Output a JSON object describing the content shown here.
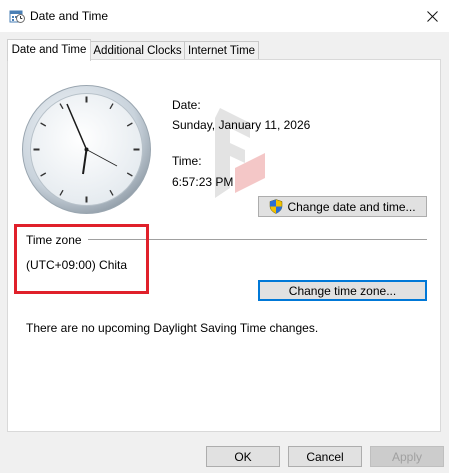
{
  "window": {
    "title": "Date and Time",
    "icon": "date-time-icon",
    "close_icon": "close-icon"
  },
  "tabs": [
    {
      "label": "Date and Time",
      "active": true
    },
    {
      "label": "Additional Clocks",
      "active": false
    },
    {
      "label": "Internet Time",
      "active": false
    }
  ],
  "datetime": {
    "date_label": "Date:",
    "date_value": "Sunday, January 11, 2026",
    "time_label": "Time:",
    "time_value": "6:57:23 PM",
    "change_button": "Change date and time...",
    "shield_icon": "uac-shield-icon"
  },
  "timezone": {
    "section_label": "Time zone",
    "value": "(UTC+09:00) Chita",
    "change_button": "Change time zone..."
  },
  "dst_message": "There are no upcoming Daylight Saving Time changes.",
  "footer": {
    "ok": "OK",
    "cancel": "Cancel",
    "apply": "Apply"
  },
  "colors": {
    "highlight": "#e0202a",
    "focus": "#0078d7"
  }
}
